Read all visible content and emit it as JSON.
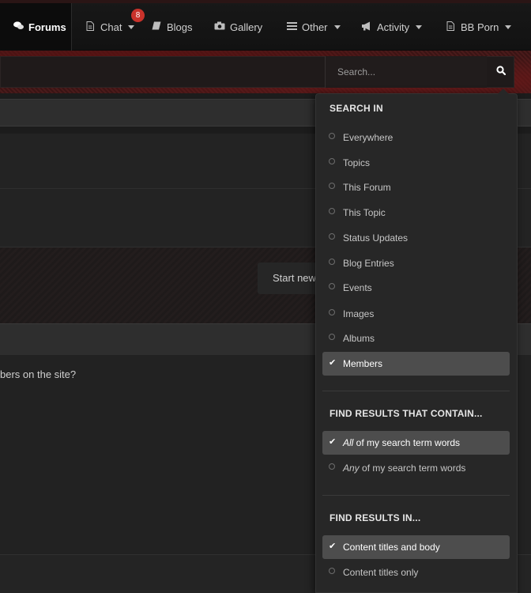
{
  "nav": {
    "items": [
      {
        "label": "Forums",
        "icon": "comments-icon"
      },
      {
        "label": "Chat",
        "icon": "document-icon",
        "badge": "8"
      },
      {
        "label": "Blogs",
        "icon": "book-icon"
      },
      {
        "label": "Gallery",
        "icon": "camera-icon"
      },
      {
        "label": "Other",
        "icon": "list-icon"
      },
      {
        "label": "Activity",
        "icon": "megaphone-icon"
      },
      {
        "label": "BB Porn",
        "icon": "document-icon"
      }
    ]
  },
  "search": {
    "placeholder": "Search..."
  },
  "background": {
    "start_new": "Start new",
    "members_question": "bers on the site?"
  },
  "dropdown": {
    "search_in": {
      "title": "SEARCH IN",
      "options": [
        "Everywhere",
        "Topics",
        "This Forum",
        "This Topic",
        "Status Updates",
        "Blog Entries",
        "Events",
        "Images",
        "Albums",
        "Members"
      ],
      "selected": "Members"
    },
    "contain": {
      "title": "FIND RESULTS THAT CONTAIN...",
      "all_em": "All",
      "all_rest": " of my search term words",
      "any_em": "Any",
      "any_rest": " of my search term words",
      "selected": "All"
    },
    "results_in": {
      "title": "FIND RESULTS IN...",
      "options": [
        "Content titles and body",
        "Content titles only"
      ],
      "selected": "Content titles and body"
    }
  },
  "colors": {
    "badge": "#c9322b",
    "selected_bg": "#4d4d4d",
    "dropdown_bg": "#272727"
  }
}
